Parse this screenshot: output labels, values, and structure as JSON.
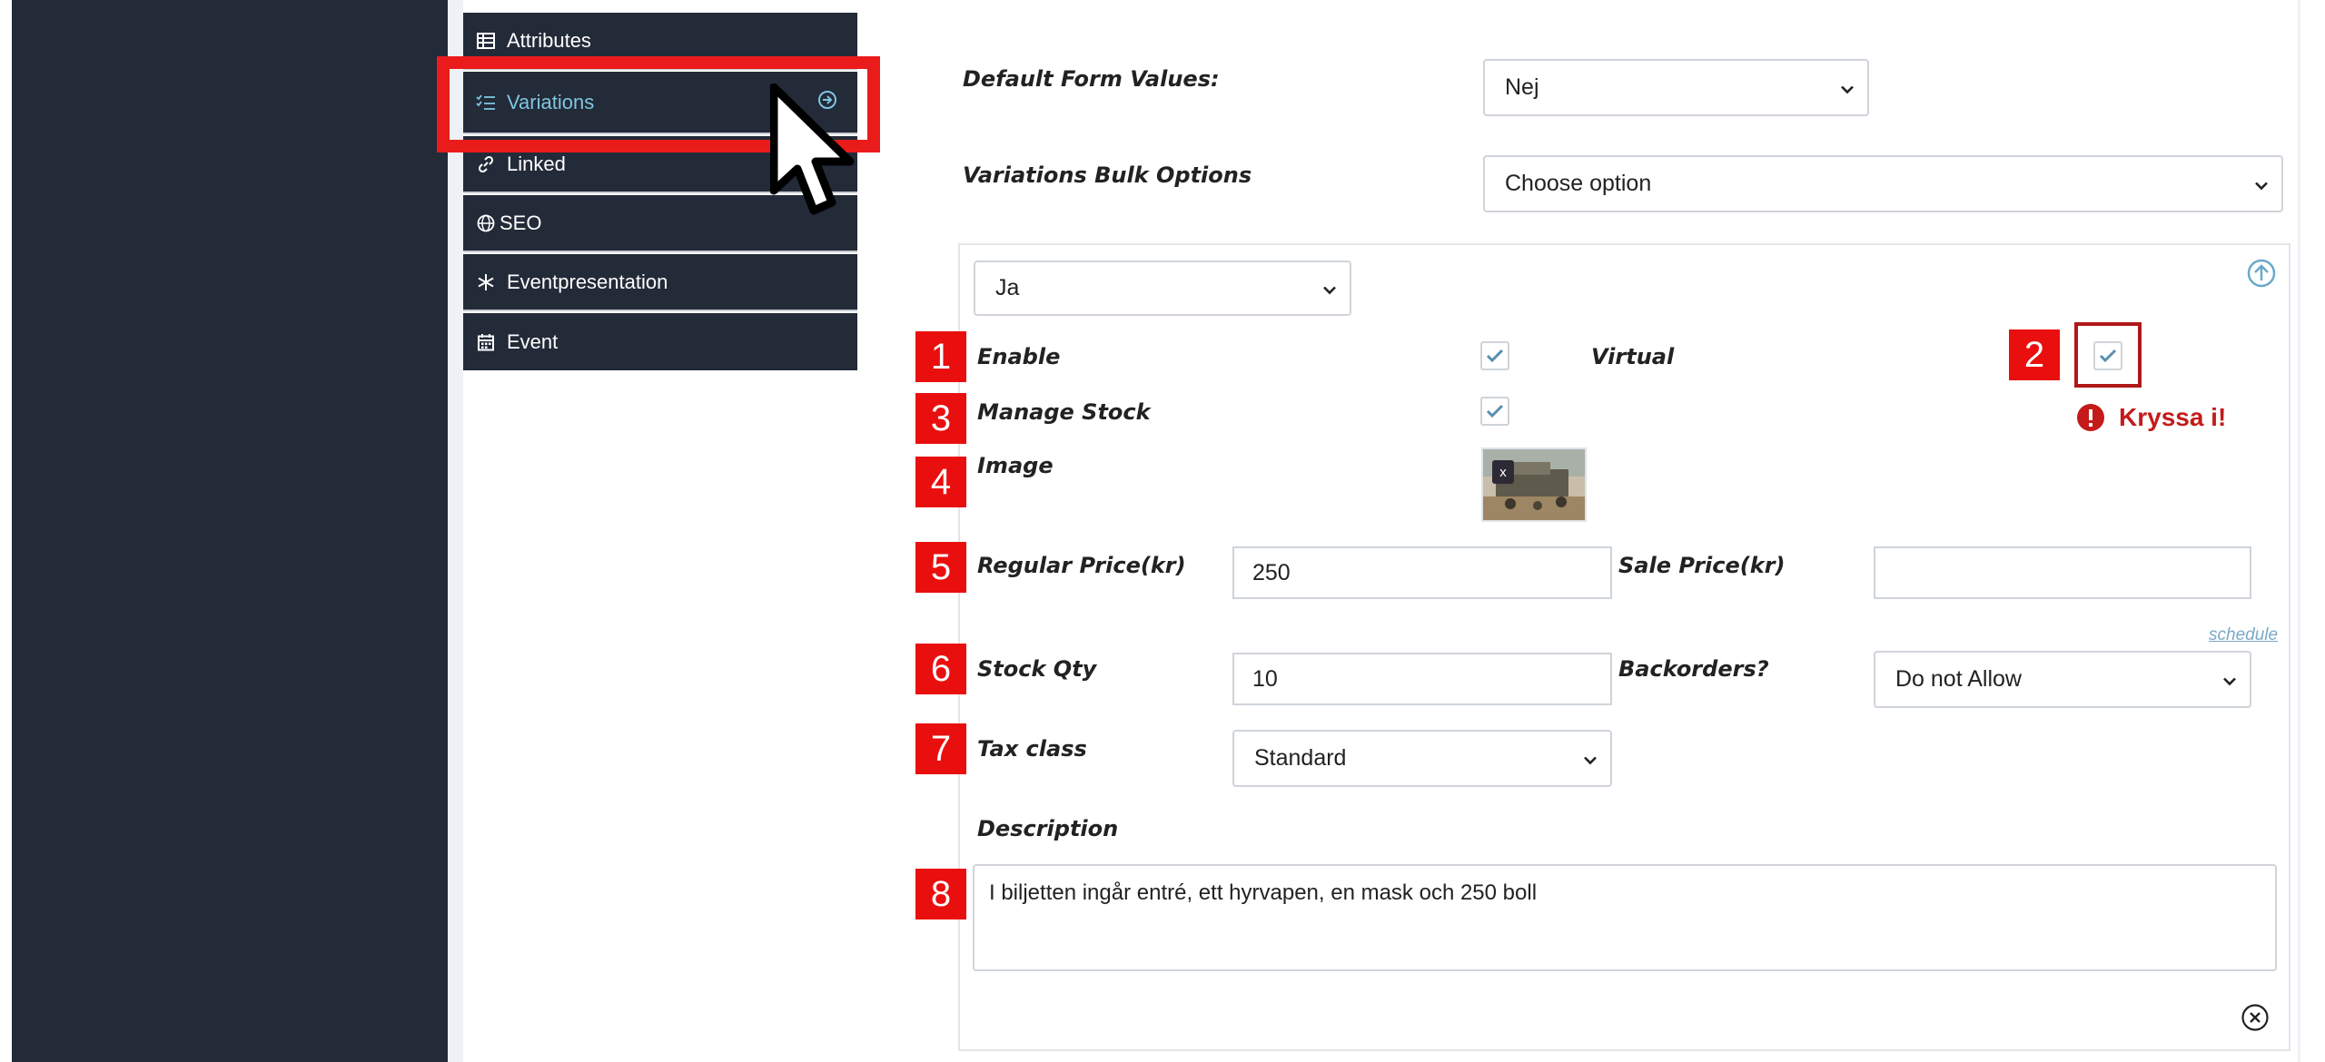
{
  "menu": {
    "items": [
      {
        "label": "Attributes",
        "icon": "table-icon"
      },
      {
        "label": "Variations",
        "icon": "checklist-icon"
      },
      {
        "label": "Linked",
        "icon": "link-icon"
      },
      {
        "label": "SEO",
        "icon": "globe-icon"
      },
      {
        "label": "Eventpresentation",
        "icon": "snowflake-icon"
      },
      {
        "label": "Event",
        "icon": "calendar-icon"
      }
    ],
    "active": "Variations"
  },
  "form": {
    "default_form_values_label": "Default Form Values:",
    "default_form_values_selected": "Nej",
    "bulk_options_label": "Variations Bulk Options",
    "bulk_options_selected": "Choose option"
  },
  "variation": {
    "attribute_selected": "Ja",
    "enable_label": "Enable",
    "enable_checked": true,
    "virtual_label": "Virtual",
    "virtual_checked": true,
    "manage_stock_label": "Manage Stock",
    "manage_stock_checked": true,
    "image_label": "Image",
    "image_remove": "x",
    "regular_price_label": "Regular Price(kr)",
    "regular_price_value": "250",
    "sale_price_label": "Sale Price(kr)",
    "sale_price_value": "",
    "schedule_link": "schedule",
    "stock_qty_label": "Stock Qty",
    "stock_qty_value": "10",
    "backorders_label": "Backorders?",
    "backorders_selected": "Do not Allow",
    "tax_class_label": "Tax class",
    "tax_class_selected": "Standard",
    "description_label": "Description",
    "description_value": "I biljetten ingår entré, ett hyrvapen, en mask och 250 boll"
  },
  "annotations": {
    "badges": [
      "1",
      "2",
      "3",
      "4",
      "5",
      "6",
      "7",
      "8"
    ],
    "warning_text": "Kryssa i!",
    "accent_color": "#ea0f0f"
  },
  "colors": {
    "sidebar": "#232a38",
    "active_menu_text": "#7ec6e0",
    "highlight": "#ea1b1b",
    "warning": "#c41a1a"
  }
}
